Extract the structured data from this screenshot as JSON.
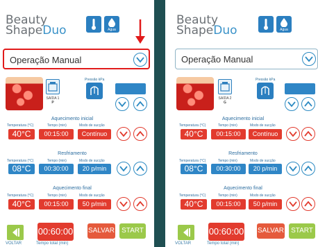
{
  "logo": {
    "line1": "Beauty",
    "line2_a": "Shape",
    "line2_b": "Duo"
  },
  "header_icons": {
    "thermometer": "thermometer-icon",
    "water_drop": "water-drop-icon",
    "water_label": "Agua"
  },
  "colors": {
    "accent_blue": "#2f86c6",
    "accent_red": "#e23b2e",
    "green": "#9bc94a",
    "divider": "#1f4f52",
    "selected_outline": "#e11a1a"
  },
  "panels": [
    {
      "mode_label": "Operação Manual",
      "saida_label": "SAÍDA 1",
      "saida_sub": "P",
      "pressure_label": "Pressão kPa",
      "sections": [
        {
          "title": "Aquecimento inicial",
          "temp_label": "Temperatura (°C)",
          "time_label": "Tempo (min)",
          "mode_label": "Modo de sucção",
          "temp": "40°C",
          "time": "00:15:00",
          "mode": "Contínuo"
        },
        {
          "title": "Resfriamento",
          "temp_label": "Temperatura (°C)",
          "time_label": "Tempo (min)",
          "mode_label": "Modo de sucção",
          "temp": "08°C",
          "time": "00:30:00",
          "mode": "20 p/min"
        },
        {
          "title": "Aquecimento final",
          "temp_label": "Temperatura (°C)",
          "time_label": "Tempo (min)",
          "mode_label": "Modo de sucção",
          "temp": "40°C",
          "time": "00:15:00",
          "mode": "50 p/min"
        }
      ],
      "total_time": "00:60:00",
      "total_label": "Tempo total (min)",
      "back_label": "VOLTAR",
      "save_label": "SALVAR",
      "start_label": "START"
    },
    {
      "mode_label": "Operação Manual",
      "saida_label": "SAÍDA 2",
      "saida_sub": "G",
      "pressure_label": "Pressão kPa",
      "sections": [
        {
          "title": "Aquecimento inicial",
          "temp_label": "Temperatura (°C)",
          "time_label": "Tempo (min)",
          "mode_label": "Modo de sucção",
          "temp": "40°C",
          "time": "00:15:00",
          "mode": "Contínuo"
        },
        {
          "title": "Resfriamento",
          "temp_label": "Temperatura (°C)",
          "time_label": "Tempo (min)",
          "mode_label": "Modo de sucção",
          "temp": "08°C",
          "time": "00:30:00",
          "mode": "20 p/min"
        },
        {
          "title": "Aquecimento final",
          "temp_label": "Temperatura (°C)",
          "time_label": "Tempo (min)",
          "mode_label": "Modo de sucção",
          "temp": "40°C",
          "time": "00:15:00",
          "mode": "50 p/min"
        }
      ],
      "total_time": "00:60:00",
      "total_label": "Tempo total (min)",
      "back_label": "VOLTAR",
      "save_label": "SALVAR",
      "start_label": "START"
    }
  ]
}
